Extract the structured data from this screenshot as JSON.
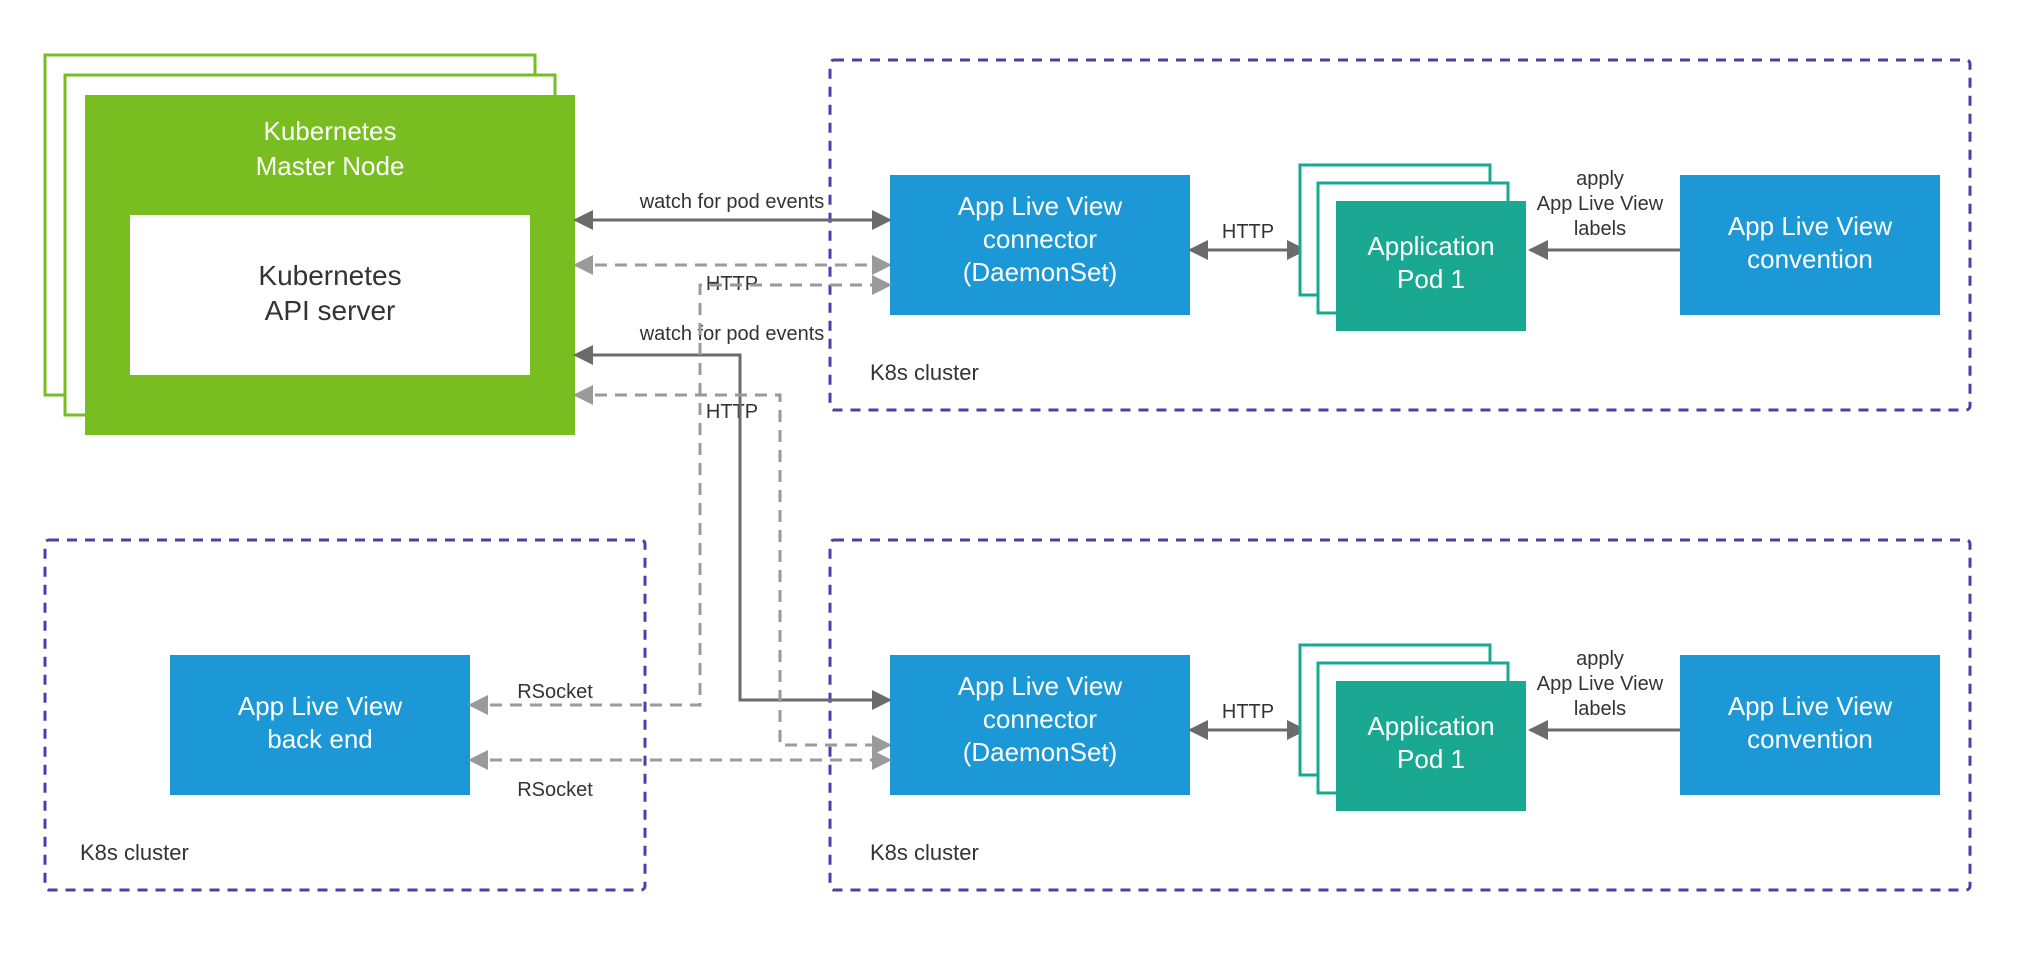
{
  "nodes": {
    "master": {
      "line1": "Kubernetes",
      "line2": "Master Node"
    },
    "api": {
      "line1": "Kubernetes",
      "line2": "API server"
    },
    "conn1": {
      "line1": "App Live View",
      "line2": "connector",
      "line3": "(DaemonSet)"
    },
    "conn2": {
      "line1": "App Live View",
      "line2": "connector",
      "line3": "(DaemonSet)"
    },
    "pod1": {
      "line1": "Application",
      "line2": "Pod 1"
    },
    "pod2": {
      "line1": "Application",
      "line2": "Pod 1"
    },
    "conv1": {
      "line1": "App Live View",
      "line2": "convention"
    },
    "conv2": {
      "line1": "App Live View",
      "line2": "convention"
    },
    "backend": {
      "line1": "App Live View",
      "line2": "back end"
    }
  },
  "edges": {
    "watch1": "watch for pod events",
    "http1": "HTTP",
    "watch2": "watch for pod events",
    "http2": "HTTP",
    "httpA": "HTTP",
    "httpB": "HTTP",
    "apply1_l1": "apply",
    "apply1_l2": "App Live View",
    "apply1_l3": "labels",
    "apply2_l1": "apply",
    "apply2_l2": "App Live View",
    "apply2_l3": "labels",
    "rsock1": "RSocket",
    "rsock2": "RSocket"
  },
  "clusters": {
    "c1": "K8s cluster",
    "c2": "K8s cluster",
    "c3": "K8s cluster"
  },
  "colors": {
    "green": "#78be20",
    "blue": "#1b98d5",
    "teal": "#1aa893",
    "purple": "#4b3fae",
    "gray": "#6b6b6b"
  }
}
